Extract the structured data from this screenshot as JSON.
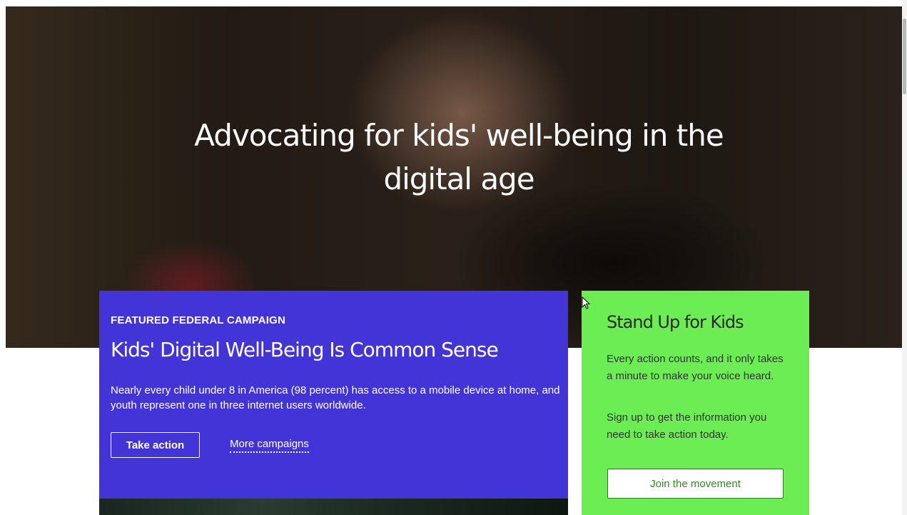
{
  "hero": {
    "title": "Advocating for kids' well-being in the digital age"
  },
  "featured_campaign": {
    "eyebrow": "FEATURED FEDERAL CAMPAIGN",
    "title": "Kids' Digital Well-Being Is Common Sense",
    "description": "Nearly every child under 8 in America (98 percent) has access to a mobile device at home, and youth represent one in three internet users worldwide.",
    "primary_button_label": "Take action",
    "secondary_link_label": "More campaigns",
    "background_color": "#4334d8"
  },
  "stand_up": {
    "title": "Stand Up for Kids",
    "paragraph_1": "Every action counts, and it only takes a minute to make your voice heard.",
    "paragraph_2": "Sign up to get the information you need to take action today.",
    "button_label": "Join the movement",
    "background_color": "#6ced54"
  },
  "icons": {
    "cursor": "arrow-cursor-icon"
  }
}
